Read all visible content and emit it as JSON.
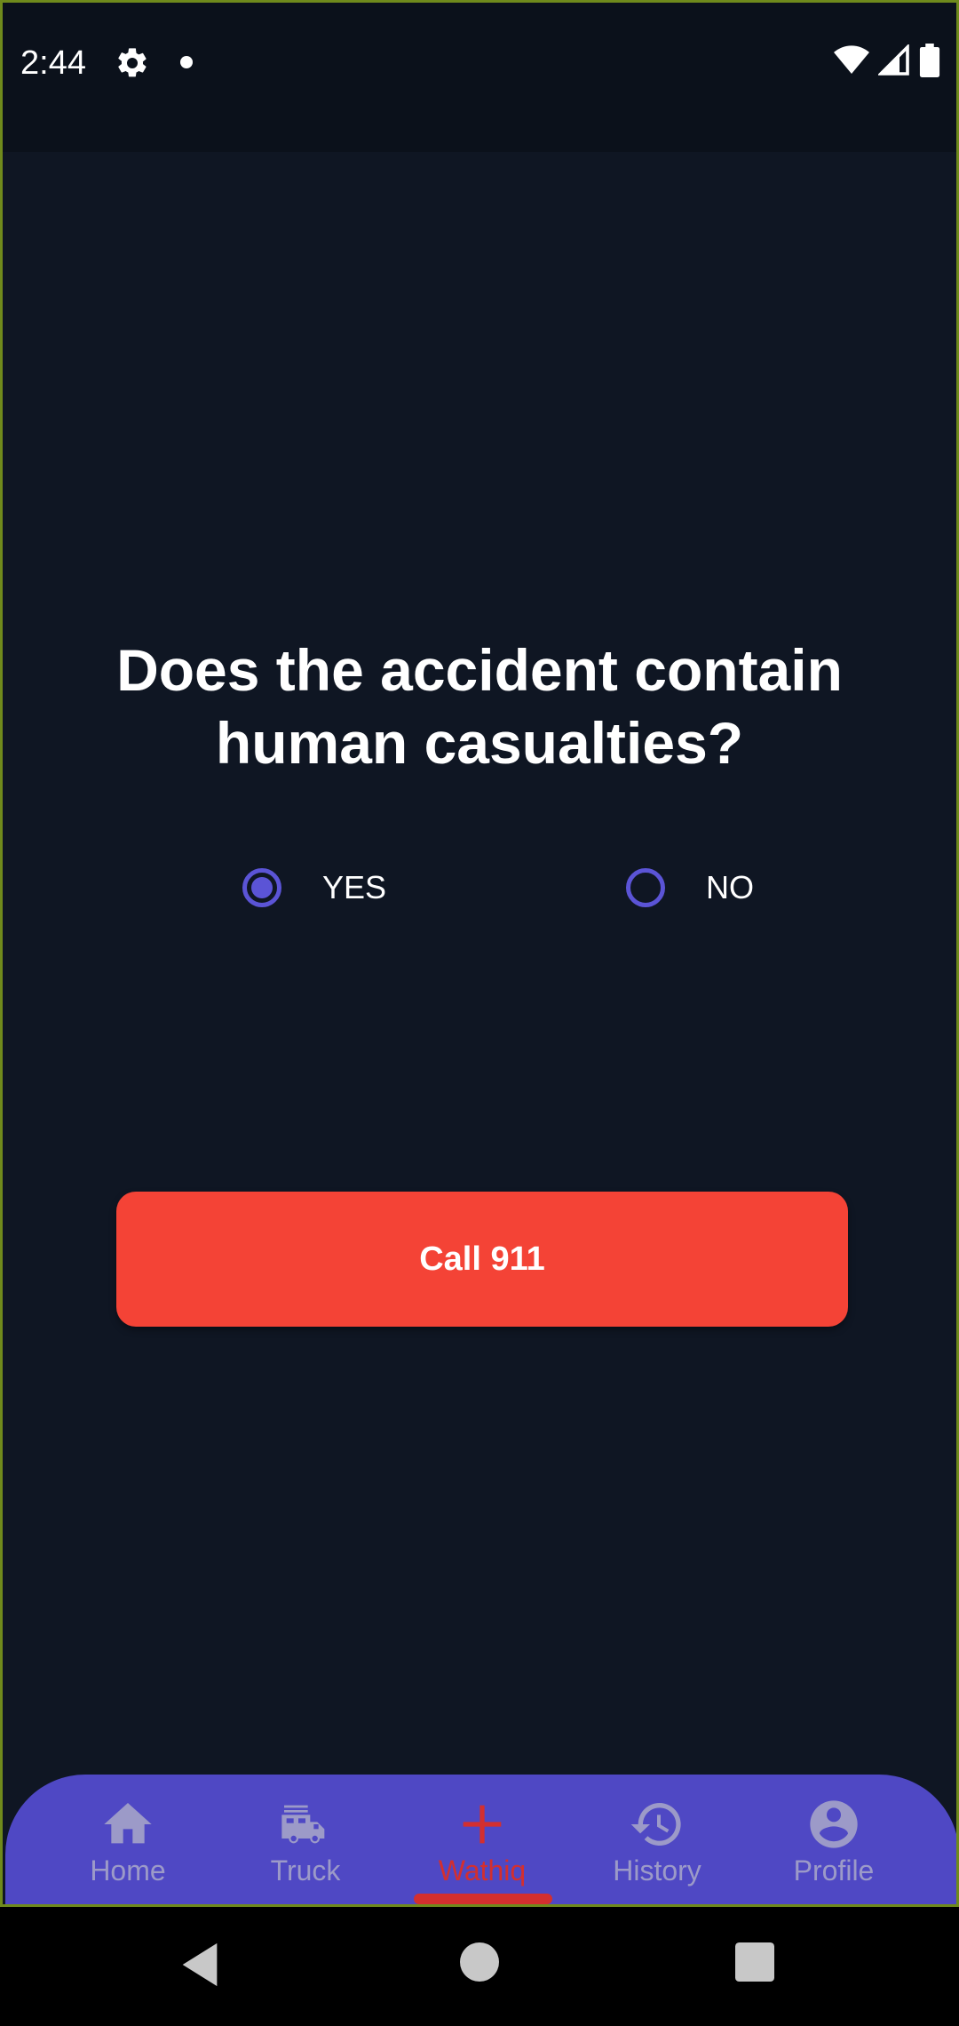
{
  "status_bar": {
    "time": "2:44",
    "icons": [
      "gear-icon",
      "notification-dot-icon",
      "wifi-icon",
      "signal-icon",
      "battery-icon"
    ]
  },
  "question": {
    "text": "Does the accident contain human casualties?"
  },
  "options": {
    "yes_label": "YES",
    "no_label": "NO",
    "selected": "YES"
  },
  "call_button": {
    "label": "Call 911",
    "color": "#f44336"
  },
  "bottom_nav": {
    "items": [
      {
        "label": "Home",
        "icon": "home-icon"
      },
      {
        "label": "Truck",
        "icon": "fire-truck-icon"
      },
      {
        "label": "Wathiq",
        "icon": "plus-icon"
      },
      {
        "label": "History",
        "icon": "history-icon"
      },
      {
        "label": "Profile",
        "icon": "profile-icon"
      }
    ],
    "active": "Wathiq",
    "background": "#4f48c4",
    "active_color": "#d32f2f"
  },
  "system_nav": {
    "icons": [
      "back-icon",
      "home-circle-icon",
      "recents-icon"
    ]
  },
  "colors": {
    "background": "#0f1623",
    "radio_accent": "#5b54d6",
    "frame_border": "#6f8a1c"
  }
}
